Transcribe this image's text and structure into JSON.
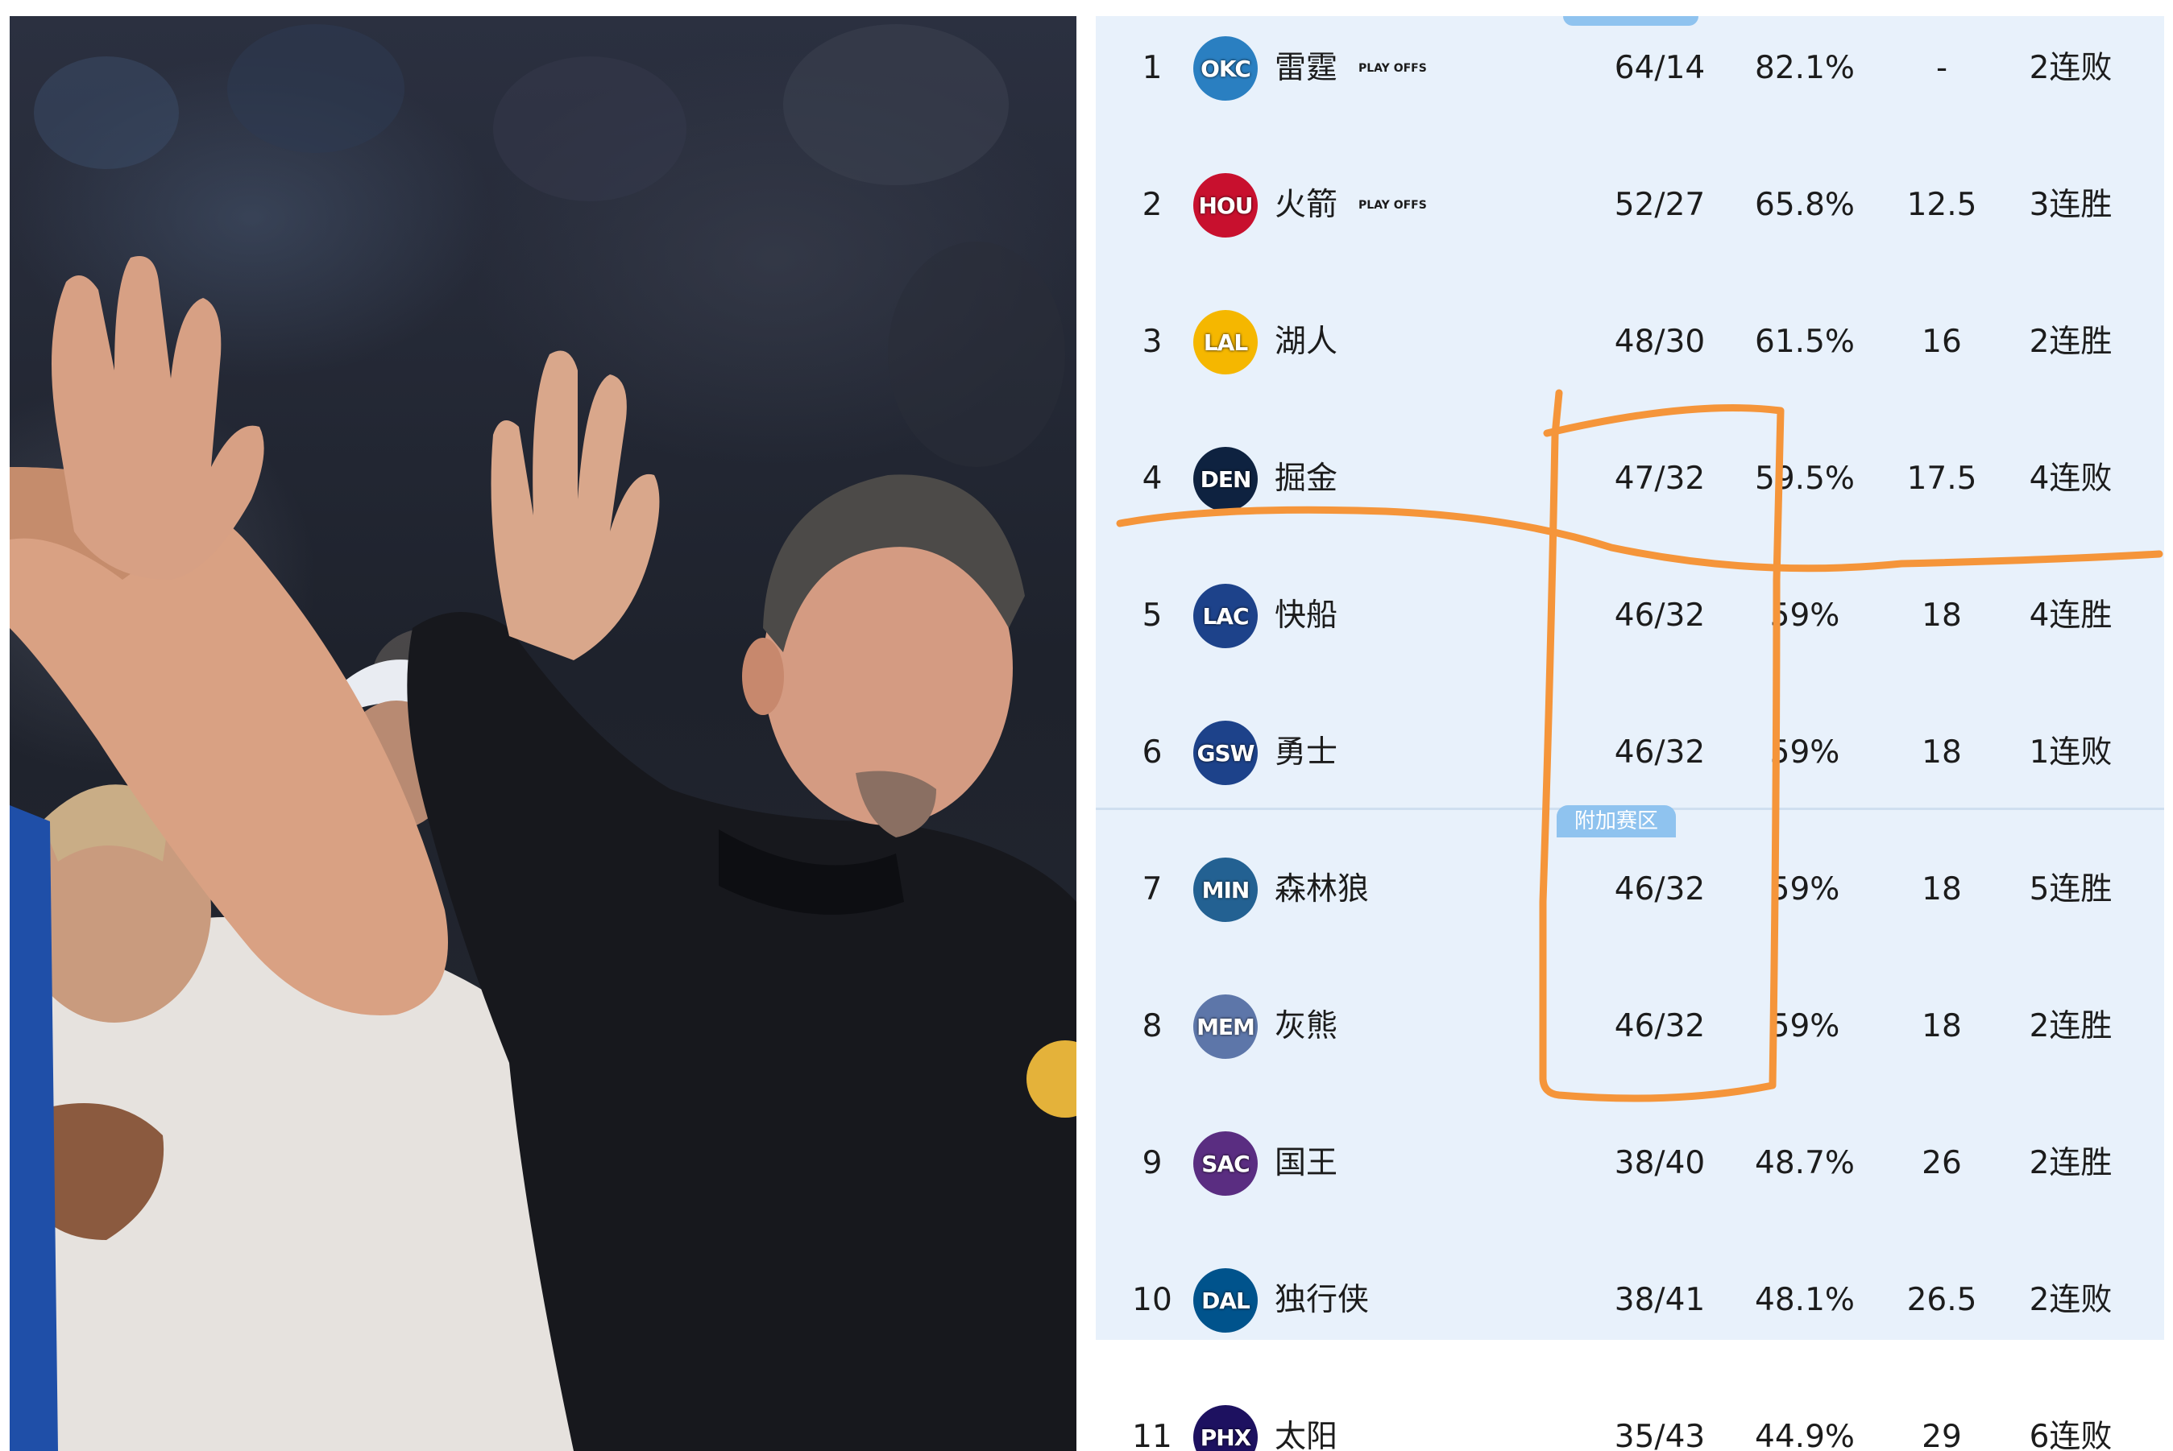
{
  "playoff_badge_text": "PLAY OFFS",
  "zones": {
    "play_in_label": "附加赛区"
  },
  "teams": [
    {
      "rank": "1",
      "abbr": "OKC",
      "name": "雷霆",
      "playoff": true,
      "record": "64/14",
      "pct": "82.1%",
      "gb": "-",
      "streak": "2连败",
      "color": "#2a7fc1"
    },
    {
      "rank": "2",
      "abbr": "HOU",
      "name": "火箭",
      "playoff": true,
      "record": "52/27",
      "pct": "65.8%",
      "gb": "12.5",
      "streak": "3连胜",
      "color": "#c8102e"
    },
    {
      "rank": "3",
      "abbr": "LAL",
      "name": "湖人",
      "playoff": false,
      "record": "48/30",
      "pct": "61.5%",
      "gb": "16",
      "streak": "2连胜",
      "color": "#f5b700"
    },
    {
      "rank": "4",
      "abbr": "DEN",
      "name": "掘金",
      "playoff": false,
      "record": "47/32",
      "pct": "59.5%",
      "gb": "17.5",
      "streak": "4连败",
      "color": "#0e2240"
    },
    {
      "rank": "5",
      "abbr": "LAC",
      "name": "快船",
      "playoff": false,
      "record": "46/32",
      "pct": "59%",
      "gb": "18",
      "streak": "4连胜",
      "color": "#1d428a"
    },
    {
      "rank": "6",
      "abbr": "GSW",
      "name": "勇士",
      "playoff": false,
      "record": "46/32",
      "pct": "59%",
      "gb": "18",
      "streak": "1连败",
      "color": "#1d428a"
    },
    {
      "rank": "7",
      "abbr": "MIN",
      "name": "森林狼",
      "playoff": false,
      "record": "46/32",
      "pct": "59%",
      "gb": "18",
      "streak": "5连胜",
      "color": "#236192"
    },
    {
      "rank": "8",
      "abbr": "MEM",
      "name": "灰熊",
      "playoff": false,
      "record": "46/32",
      "pct": "59%",
      "gb": "18",
      "streak": "2连胜",
      "color": "#5d76a9"
    },
    {
      "rank": "9",
      "abbr": "SAC",
      "name": "国王",
      "playoff": false,
      "record": "38/40",
      "pct": "48.7%",
      "gb": "26",
      "streak": "2连胜",
      "color": "#5a2d81"
    },
    {
      "rank": "10",
      "abbr": "DAL",
      "name": "独行侠",
      "playoff": false,
      "record": "38/41",
      "pct": "48.1%",
      "gb": "26.5",
      "streak": "2连败",
      "color": "#00538c"
    },
    {
      "rank": "11",
      "abbr": "PHX",
      "name": "太阳",
      "playoff": false,
      "record": "35/43",
      "pct": "44.9%",
      "gb": "29",
      "streak": "6连败",
      "color": "#1d1160"
    }
  ],
  "colors": {
    "annotation": "#f5953a",
    "playoff_zone_bg": "#e8f1fb",
    "zone_tag": "#8fc3ef"
  }
}
